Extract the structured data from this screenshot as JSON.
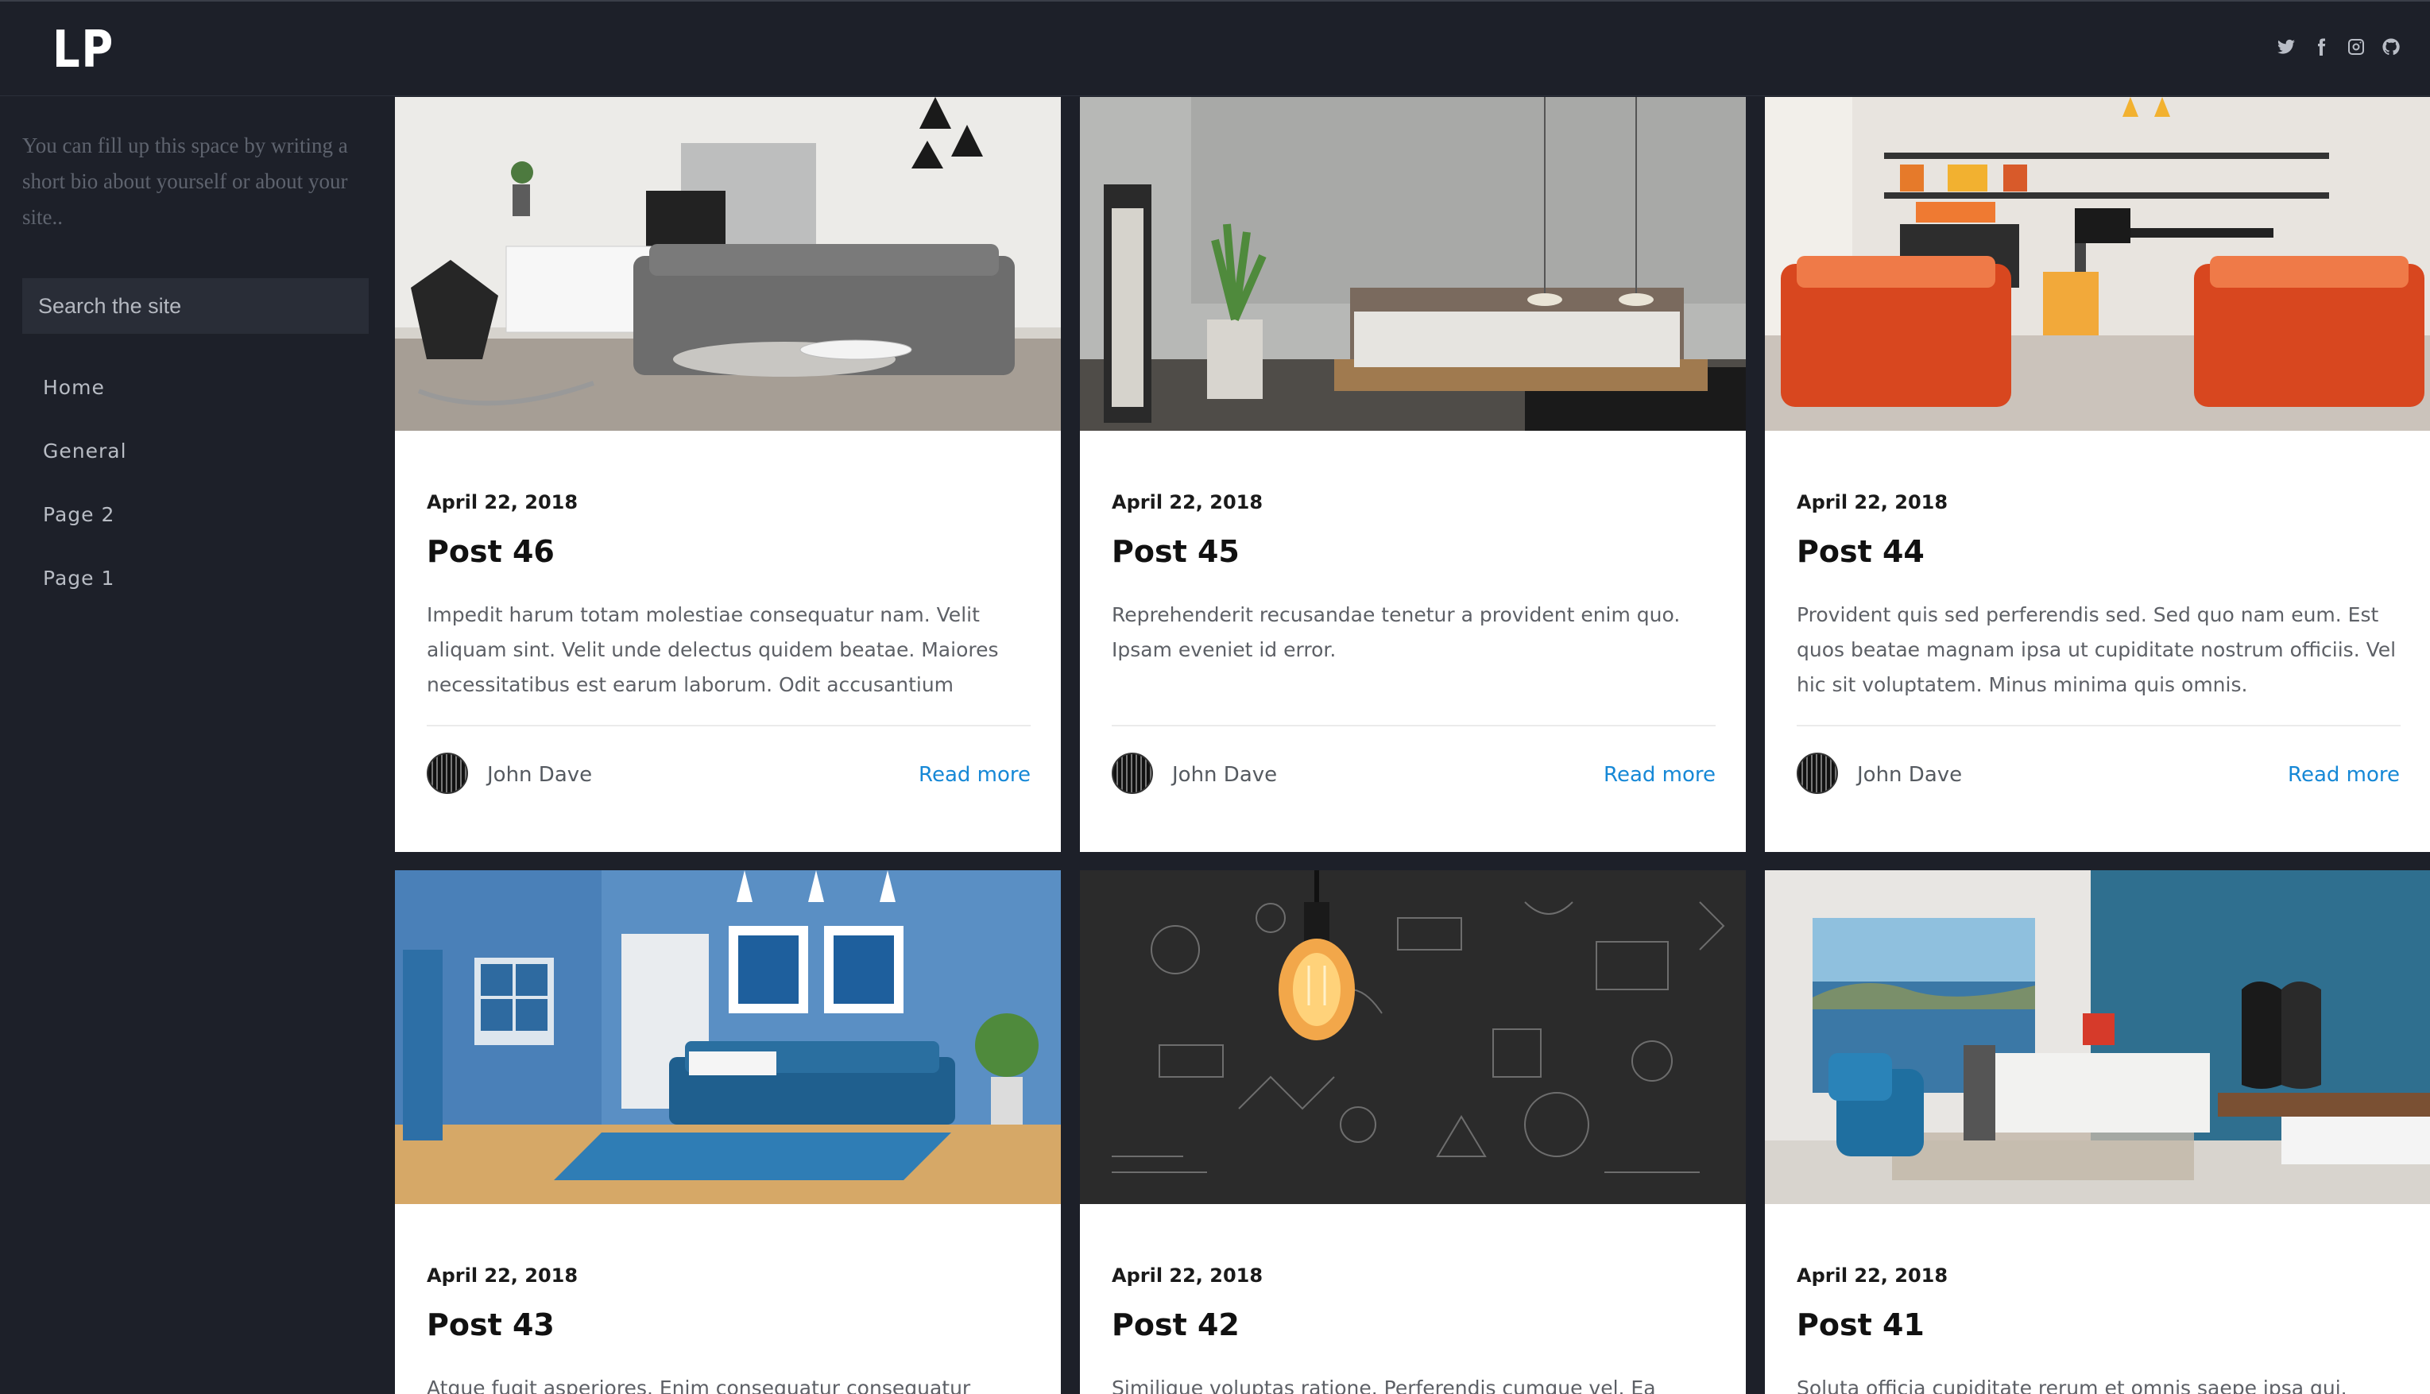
{
  "header": {
    "logo": "LP",
    "social_icons": [
      "twitter-icon",
      "facebook-icon",
      "instagram-icon",
      "github-icon"
    ]
  },
  "sidebar": {
    "bio": "You can fill up this space by writing a short bio about yourself or about your site..",
    "search_placeholder": "Search the site",
    "nav": [
      "Home",
      "General",
      "Page 2",
      "Page 1"
    ]
  },
  "posts": [
    {
      "date": "April 22, 2018",
      "title": "Post 46",
      "excerpt": "Impedit harum totam molestiae consequatur nam. Velit aliquam sint. Velit unde delectus quidem beatae. Maiores necessitatibus est earum laborum. Odit accusantium doloremque sint veniam…",
      "author": "John Dave",
      "read_more": "Read more"
    },
    {
      "date": "April 22, 2018",
      "title": "Post 45",
      "excerpt": "Reprehenderit recusandae tenetur a provident enim quo. Ipsam eveniet id error.",
      "author": "John Dave",
      "read_more": "Read more"
    },
    {
      "date": "April 22, 2018",
      "title": "Post 44",
      "excerpt": "Provident quis sed perferendis sed. Sed quo nam eum. Est quos beatae magnam ipsa ut cupiditate nostrum officiis. Vel hic sit voluptatem. Minus minima quis omnis.",
      "author": "John Dave",
      "read_more": "Read more"
    },
    {
      "date": "April 22, 2018",
      "title": "Post 43",
      "excerpt": "Atque fugit asperiores. Enim consequatur consequatur reiciendis"
    },
    {
      "date": "April 22, 2018",
      "title": "Post 42",
      "excerpt": "Similique voluptas ratione. Perferendis cumque vel. Ea occaecati"
    },
    {
      "date": "April 22, 2018",
      "title": "Post 41",
      "excerpt": "Soluta officia cupiditate rerum et omnis saepe ipsa qui. Totam"
    }
  ],
  "colors": {
    "background": "#1d2029",
    "card": "#ffffff",
    "link": "#1688d6",
    "sidebar_text": "#b8bcc4"
  }
}
